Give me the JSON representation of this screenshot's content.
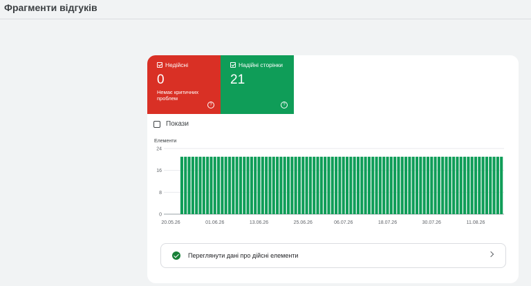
{
  "header": {
    "title": "Фрагменти відгуків"
  },
  "tiles": [
    {
      "label": "Недійсні",
      "value": "0",
      "subtitle": "Немає критичних проблем",
      "color": "#d93025"
    },
    {
      "label": "Надійні сторінки",
      "value": "21",
      "subtitle": "",
      "color": "#0f9d58"
    }
  ],
  "impressions": {
    "label": "Покази",
    "checked": false
  },
  "chart_data": {
    "type": "bar",
    "ylabel": "Елементи",
    "ylim": [
      0,
      24
    ],
    "yticks": [
      0,
      8,
      16,
      24
    ],
    "xtick_labels": [
      "20.05.26",
      "01.06.26",
      "13.06.26",
      "25.06.26",
      "06.07.26",
      "18.07.26",
      "30.07.26",
      "11.08.26"
    ],
    "start_date": "2026-05-23",
    "end_date": "2026-08-18",
    "daily_value": 21,
    "bar_color": "#0f9d58",
    "grid": true
  },
  "action": {
    "label": "Переглянути дані про дійсні елементи"
  }
}
